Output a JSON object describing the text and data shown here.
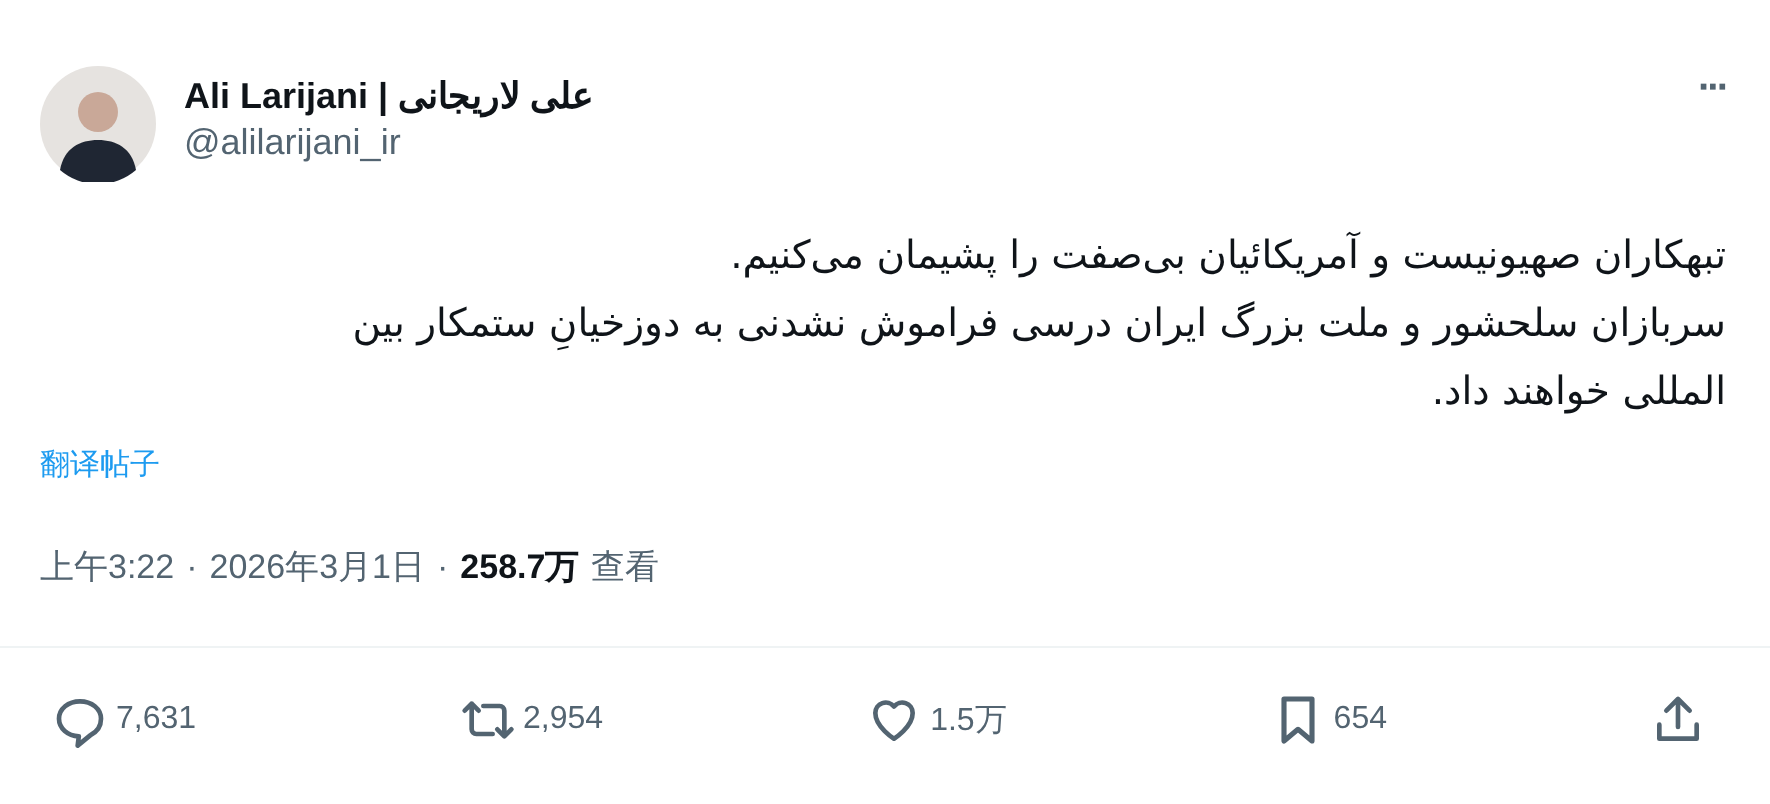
{
  "author": {
    "name": "Ali Larijani | علی لاریجانی",
    "handle": "@alilarijani_ir"
  },
  "more": "···",
  "body": [
    "تبهکاران صهیونیست و آمریکائیان بی‌صفت را پشیمان می‌کنیم.",
    "سربازان سلحشور و ملت بزرگ ایران درسی فراموش نشدنی به دوزخیانِ ستمکار بین المللی خواهند داد."
  ],
  "translate_link": "翻译帖子",
  "meta": {
    "time": "上午3:22",
    "separator": "·",
    "date": "2026年3月1日",
    "views": "258.7万",
    "views_label": "查看"
  },
  "actions": [
    {
      "kind": "reply",
      "count": "7,631"
    },
    {
      "kind": "retweet",
      "count": "2,954"
    },
    {
      "kind": "like",
      "count": "1.5万"
    },
    {
      "kind": "bookmark",
      "count": "654"
    },
    {
      "kind": "share"
    }
  ]
}
